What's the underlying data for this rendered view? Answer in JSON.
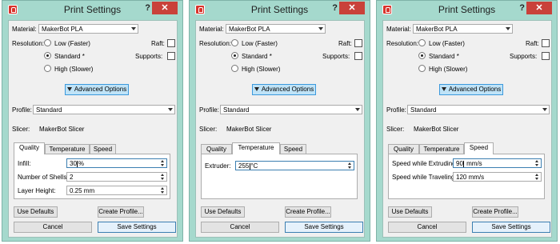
{
  "dialog": {
    "title": "Print Settings",
    "help": "?",
    "close": "✕",
    "material_label": "Material:",
    "material_value": "MakerBot PLA",
    "resolution_label": "Resolution:",
    "res_low": "Low (Faster)",
    "res_standard": "Standard *",
    "res_high": "High (Slower)",
    "raft_label": "Raft:",
    "supports_label": "Supports:",
    "advanced_button": "Advanced Options",
    "profile_label": "Profile:",
    "profile_value": "Standard",
    "slicer_label": "Slicer:",
    "slicer_value": "MakerBot Slicer",
    "tab_quality": "Quality",
    "tab_temperature": "Temperature",
    "tab_speed": "Speed",
    "use_defaults": "Use Defaults",
    "create_profile": "Create Profile...",
    "cancel": "Cancel",
    "save": "Save Settings"
  },
  "quality": {
    "infill_label": "Infill:",
    "infill_before": "30",
    "infill_after": "%",
    "shells_label": "Number of Shells:",
    "shells_value": "2",
    "layer_label": "Layer Height:",
    "layer_value": "0.25 mm"
  },
  "temperature": {
    "extruder_label": "Extruder:",
    "extruder_before": "255",
    "extruder_after": "°C"
  },
  "speed": {
    "extruding_label": "Speed while Extruding:",
    "extruding_before": "90",
    "extruding_after": " mm/s",
    "traveling_label": "Speed while Traveling:",
    "traveling_value": "120 mm/s"
  },
  "colors": {
    "frame": "#a5d9cd",
    "close_button": "#c9413a",
    "advanced_button": "#bfe3f7",
    "app_icon": "#d8342c"
  },
  "icons": {
    "app": "makerbot-logo-icon",
    "dropdown": "chevron-down-icon",
    "expand": "triangle-down-icon",
    "spinner": "spin-arrows-icon"
  }
}
